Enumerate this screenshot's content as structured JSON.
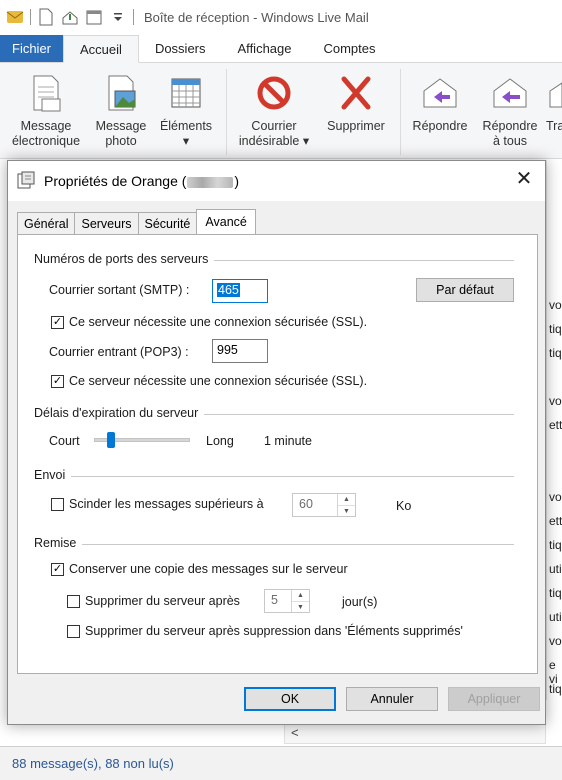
{
  "app": {
    "title": "Boîte de réception - Windows Live Mail",
    "menu": [
      "Fichier",
      "Accueil",
      "Dossiers",
      "Affichage",
      "Comptes"
    ],
    "ribbon": {
      "message_electronique": [
        "Message",
        "électronique"
      ],
      "message_photo": [
        "Message",
        "photo"
      ],
      "elements": [
        "Éléments",
        "▾"
      ],
      "courrier_indesirable": [
        "Courrier",
        "indésirable ▾"
      ],
      "supprimer": "Supprimer",
      "repondre": "Répondre",
      "repondre_a_tous": [
        "Répondre",
        "à tous"
      ],
      "tr": "Tra"
    },
    "right_strip": [
      "vo",
      "tiq",
      "tiq",
      "vo",
      "ett",
      "vo",
      "ett",
      "tiq",
      "uti",
      "tiq",
      "uti",
      "vo",
      "e vi",
      "tiq",
      "uti"
    ],
    "scroll_glyph": "<",
    "status": "88 message(s), 88 non lu(s)"
  },
  "dialog": {
    "title_prefix": "Propriétés de Orange (",
    "title_suffix": ")",
    "close": "✕",
    "tabs": [
      "Général",
      "Serveurs",
      "Sécurité",
      "Avancé"
    ],
    "ports": {
      "group": "Numéros de ports des serveurs",
      "smtp_label": "Courrier sortant (SMTP) :",
      "smtp_value": "465",
      "default_button": "Par défaut",
      "ssl_smtp": "Ce serveur nécessite une connexion sécurisée (SSL).",
      "pop3_label": "Courrier entrant (POP3) :",
      "pop3_value": "995",
      "ssl_pop3": "Ce serveur nécessite une connexion sécurisée (SSL)."
    },
    "timeout": {
      "group": "Délais d'expiration du serveur",
      "short": "Court",
      "long": "Long",
      "value": "1 minute",
      "level": 0.15
    },
    "envoi": {
      "group": "Envoi",
      "split_label": "Scinder les messages supérieurs à",
      "split_value": "60",
      "unit": "Ko"
    },
    "remise": {
      "group": "Remise",
      "keep_copy": "Conserver une copie des messages sur le serveur",
      "delete_after": "Supprimer du serveur après",
      "delete_after_value": "5",
      "days": "jour(s)",
      "delete_on_trash": "Supprimer du serveur après suppression dans 'Éléments supprimés'"
    },
    "buttons": {
      "ok": "OK",
      "cancel": "Annuler",
      "apply": "Appliquer"
    }
  }
}
